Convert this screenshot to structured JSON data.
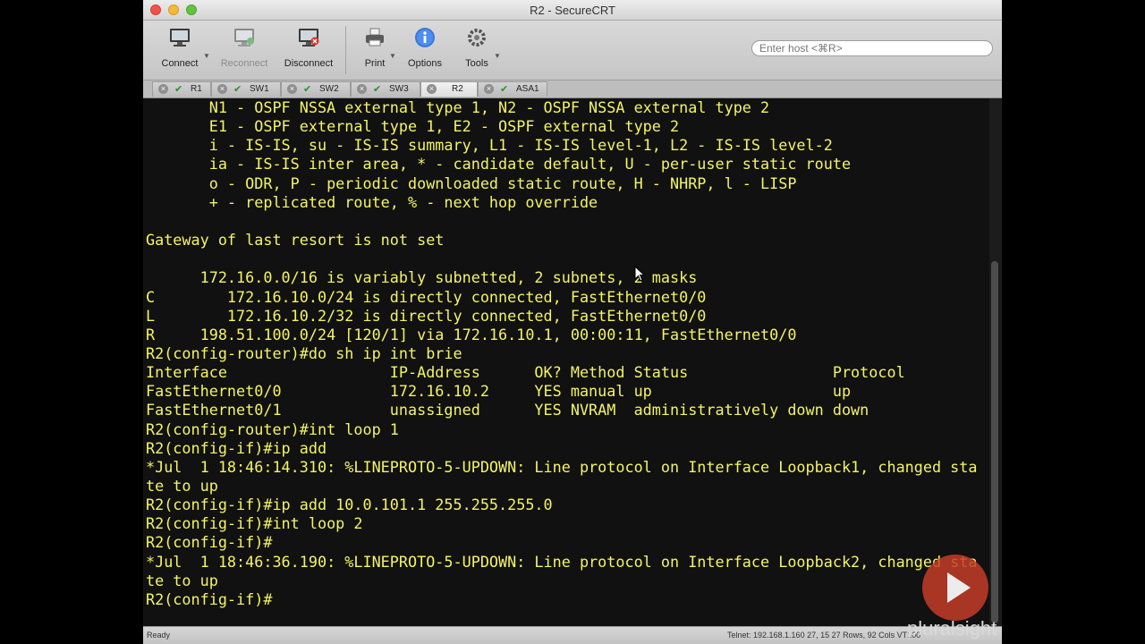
{
  "window": {
    "title": "R2 - SecureCRT"
  },
  "toolbar": {
    "connect": "Connect",
    "reconnect": "Reconnect",
    "disconnect": "Disconnect",
    "print": "Print",
    "options": "Options",
    "tools": "Tools",
    "host_placeholder": "Enter host <⌘R>"
  },
  "tabs": [
    "R1",
    "SW1",
    "SW2",
    "SW3",
    "R2",
    "ASA1"
  ],
  "active_tab": "R2",
  "terminal": {
    "lines": [
      "       N1 - OSPF NSSA external type 1, N2 - OSPF NSSA external type 2",
      "       E1 - OSPF external type 1, E2 - OSPF external type 2",
      "       i - IS-IS, su - IS-IS summary, L1 - IS-IS level-1, L2 - IS-IS level-2",
      "       ia - IS-IS inter area, * - candidate default, U - per-user static route",
      "       o - ODR, P - periodic downloaded static route, H - NHRP, l - LISP",
      "       + - replicated route, % - next hop override",
      "",
      "Gateway of last resort is not set",
      "",
      "      172.16.0.0/16 is variably subnetted, 2 subnets, 2 masks",
      "C        172.16.10.0/24 is directly connected, FastEthernet0/0",
      "L        172.16.10.2/32 is directly connected, FastEthernet0/0",
      "R     198.51.100.0/24 [120/1] via 172.16.10.1, 00:00:11, FastEthernet0/0",
      "R2(config-router)#do sh ip int brie",
      "Interface                  IP-Address      OK? Method Status                Protocol",
      "FastEthernet0/0            172.16.10.2     YES manual up                    up",
      "FastEthernet0/1            unassigned      YES NVRAM  administratively down down",
      "R2(config-router)#int loop 1",
      "R2(config-if)#ip add",
      "*Jul  1 18:46:14.310: %LINEPROTO-5-UPDOWN: Line protocol on Interface Loopback1, changed sta",
      "te to up",
      "R2(config-if)#ip add 10.0.101.1 255.255.255.0",
      "R2(config-if)#int loop 2",
      "R2(config-if)#",
      "*Jul  1 18:46:36.190: %LINEPROTO-5-UPDOWN: Line protocol on Interface Loopback2, changed sta",
      "te to up",
      "R2(config-if)#"
    ]
  },
  "status": {
    "left": "Ready",
    "right": "Telnet: 192.168.1.160  27, 15  27 Rows, 92 Cols  VT100"
  },
  "watermark": {
    "brand": "pluralsight"
  },
  "colors": {
    "terminal_fg": "#f4f466",
    "terminal_bg": "#111111"
  }
}
